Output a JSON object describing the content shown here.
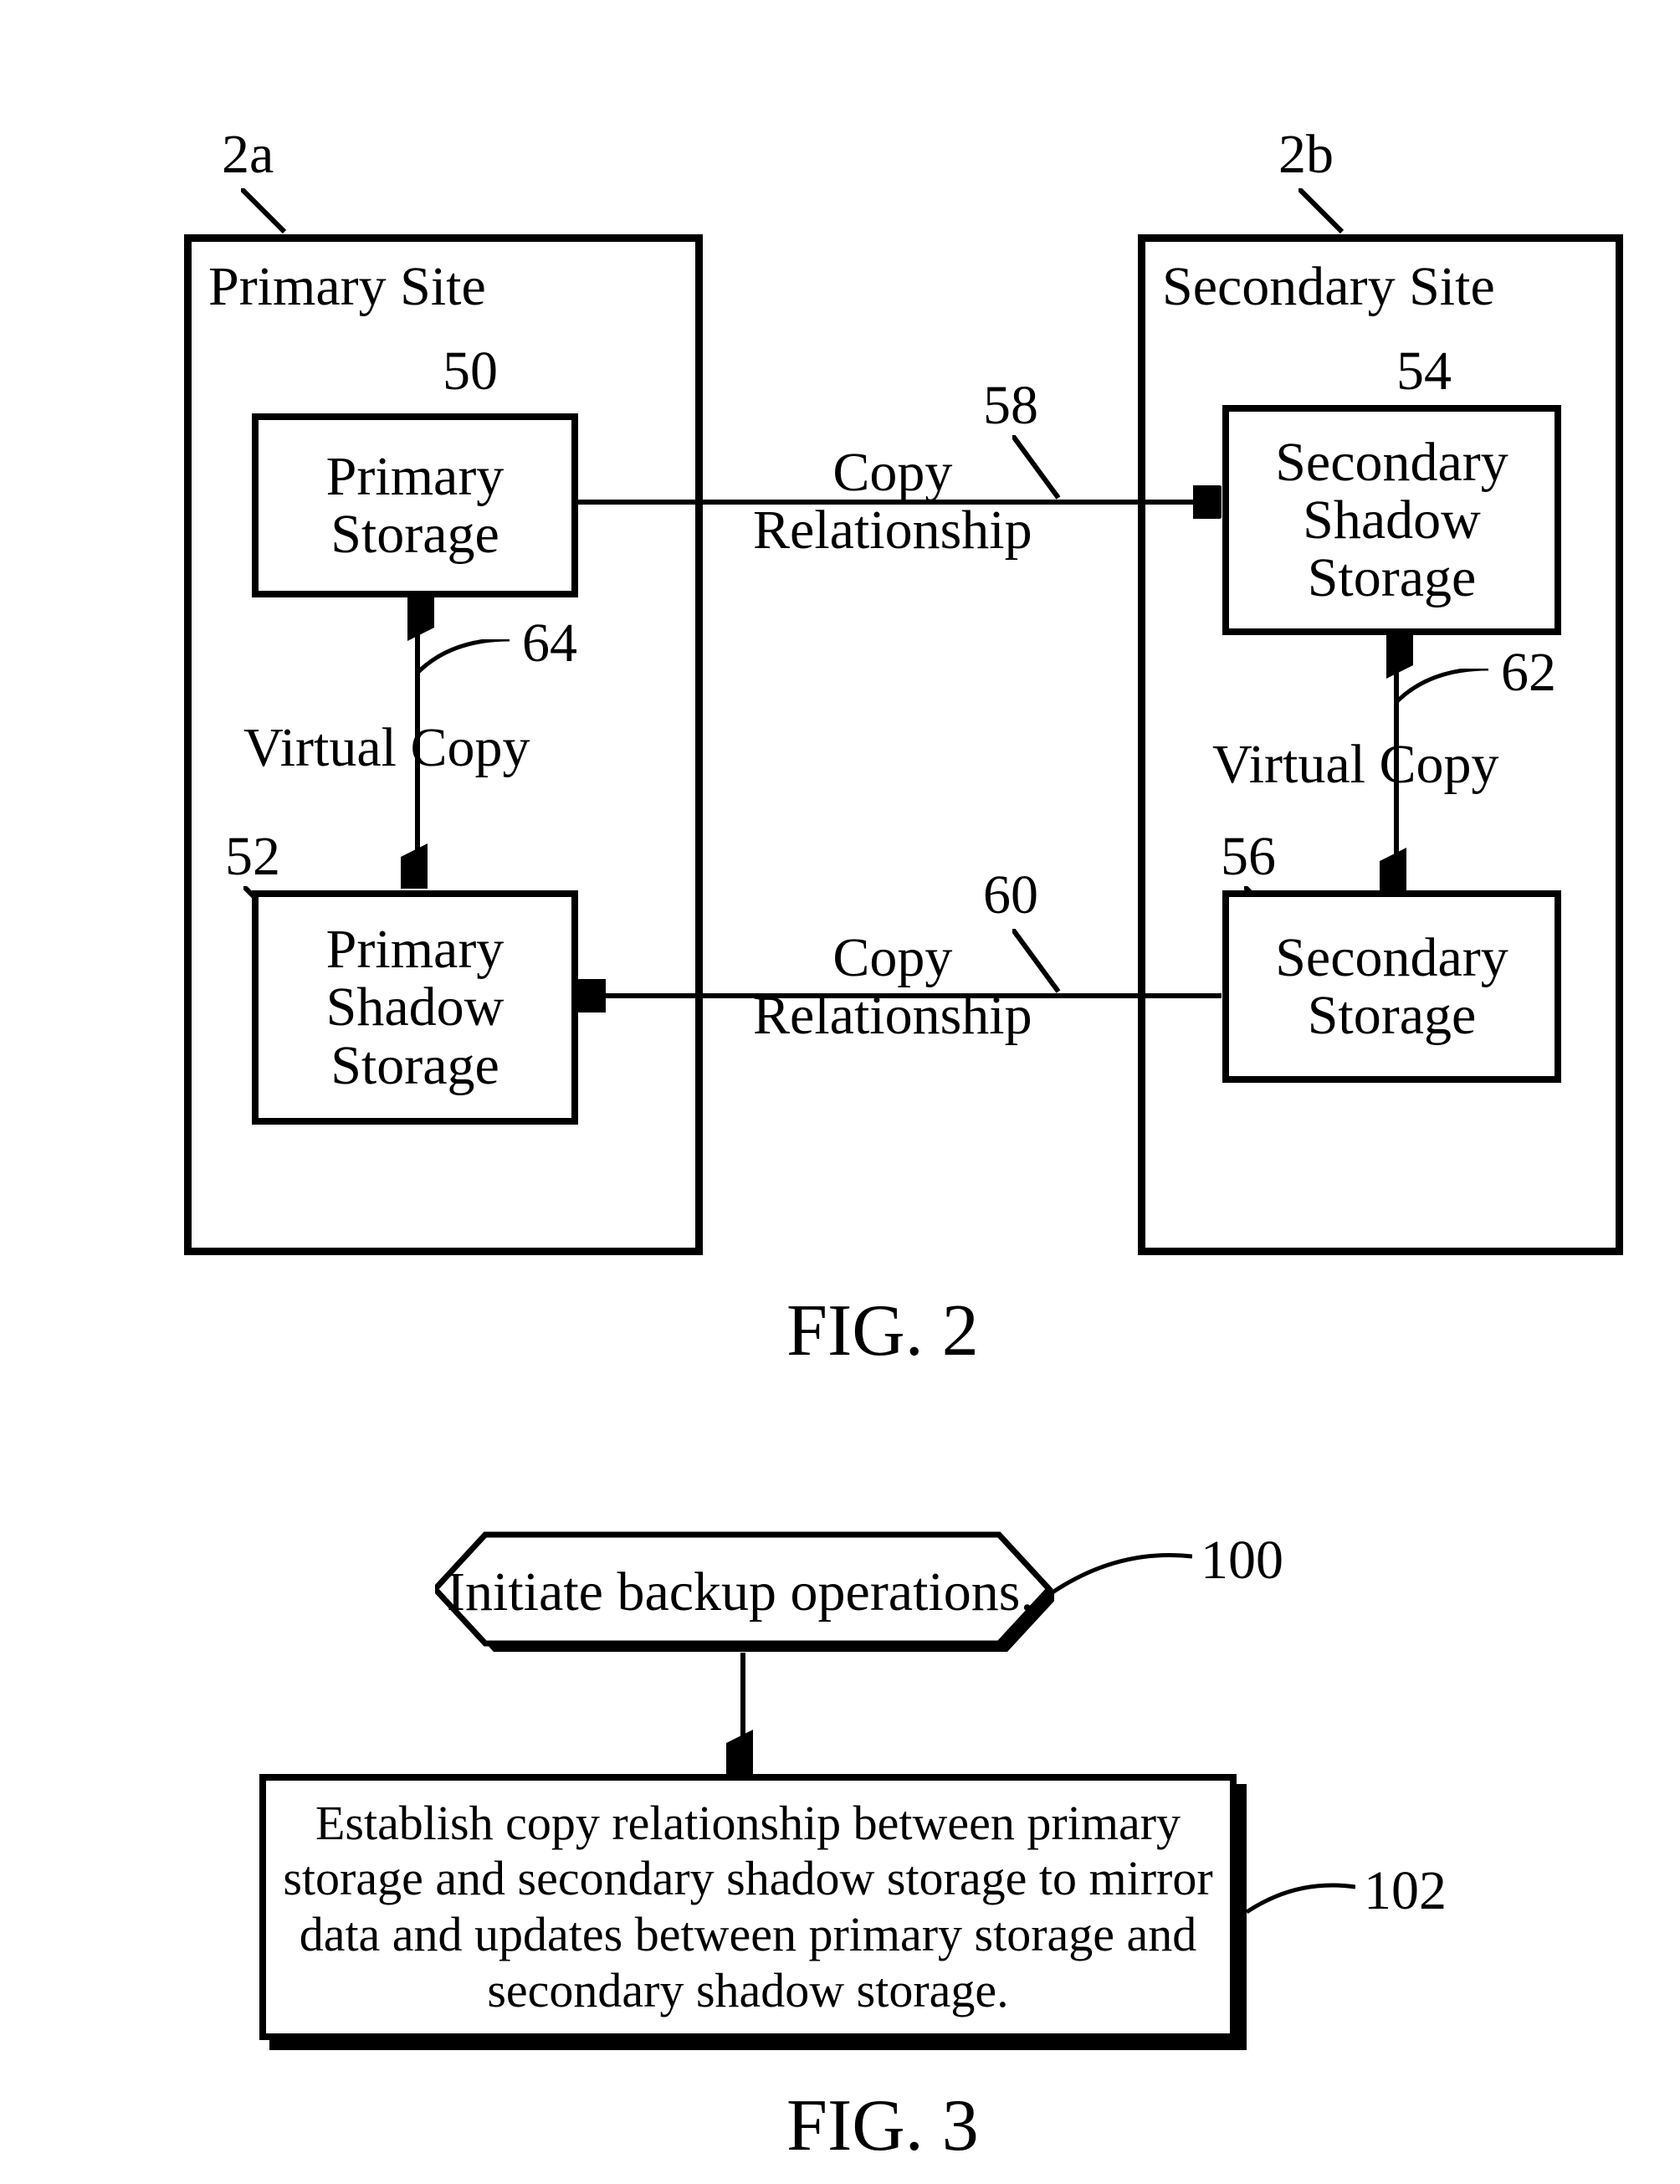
{
  "fig2": {
    "primary": {
      "ref": "2a",
      "title": "Primary Site",
      "storage": {
        "ref": "50",
        "label": "Primary\nStorage"
      },
      "shadow": {
        "ref": "52",
        "label": "Primary\nShadow\nStorage"
      },
      "vcopy": {
        "ref": "64",
        "label": "Virtual Copy"
      }
    },
    "secondary": {
      "ref": "2b",
      "title": "Secondary Site",
      "shadow": {
        "ref": "54",
        "label": "Secondary\nShadow\nStorage"
      },
      "storage": {
        "ref": "56",
        "label": "Secondary\nStorage"
      },
      "vcopy": {
        "ref": "62",
        "label": "Virtual Copy"
      }
    },
    "top_rel": {
      "ref": "58",
      "label": "Copy\nRelationship"
    },
    "bot_rel": {
      "ref": "60",
      "label": "Copy\nRelationship"
    },
    "caption": "FIG. 2"
  },
  "fig3": {
    "step100": {
      "ref": "100",
      "label": "Initiate backup operations."
    },
    "step102": {
      "ref": "102",
      "label": "Establish copy relationship between primary\nstorage and secondary shadow storage to mirror\ndata and updates between primary storage and\nsecondary shadow storage."
    },
    "caption": "FIG. 3"
  }
}
